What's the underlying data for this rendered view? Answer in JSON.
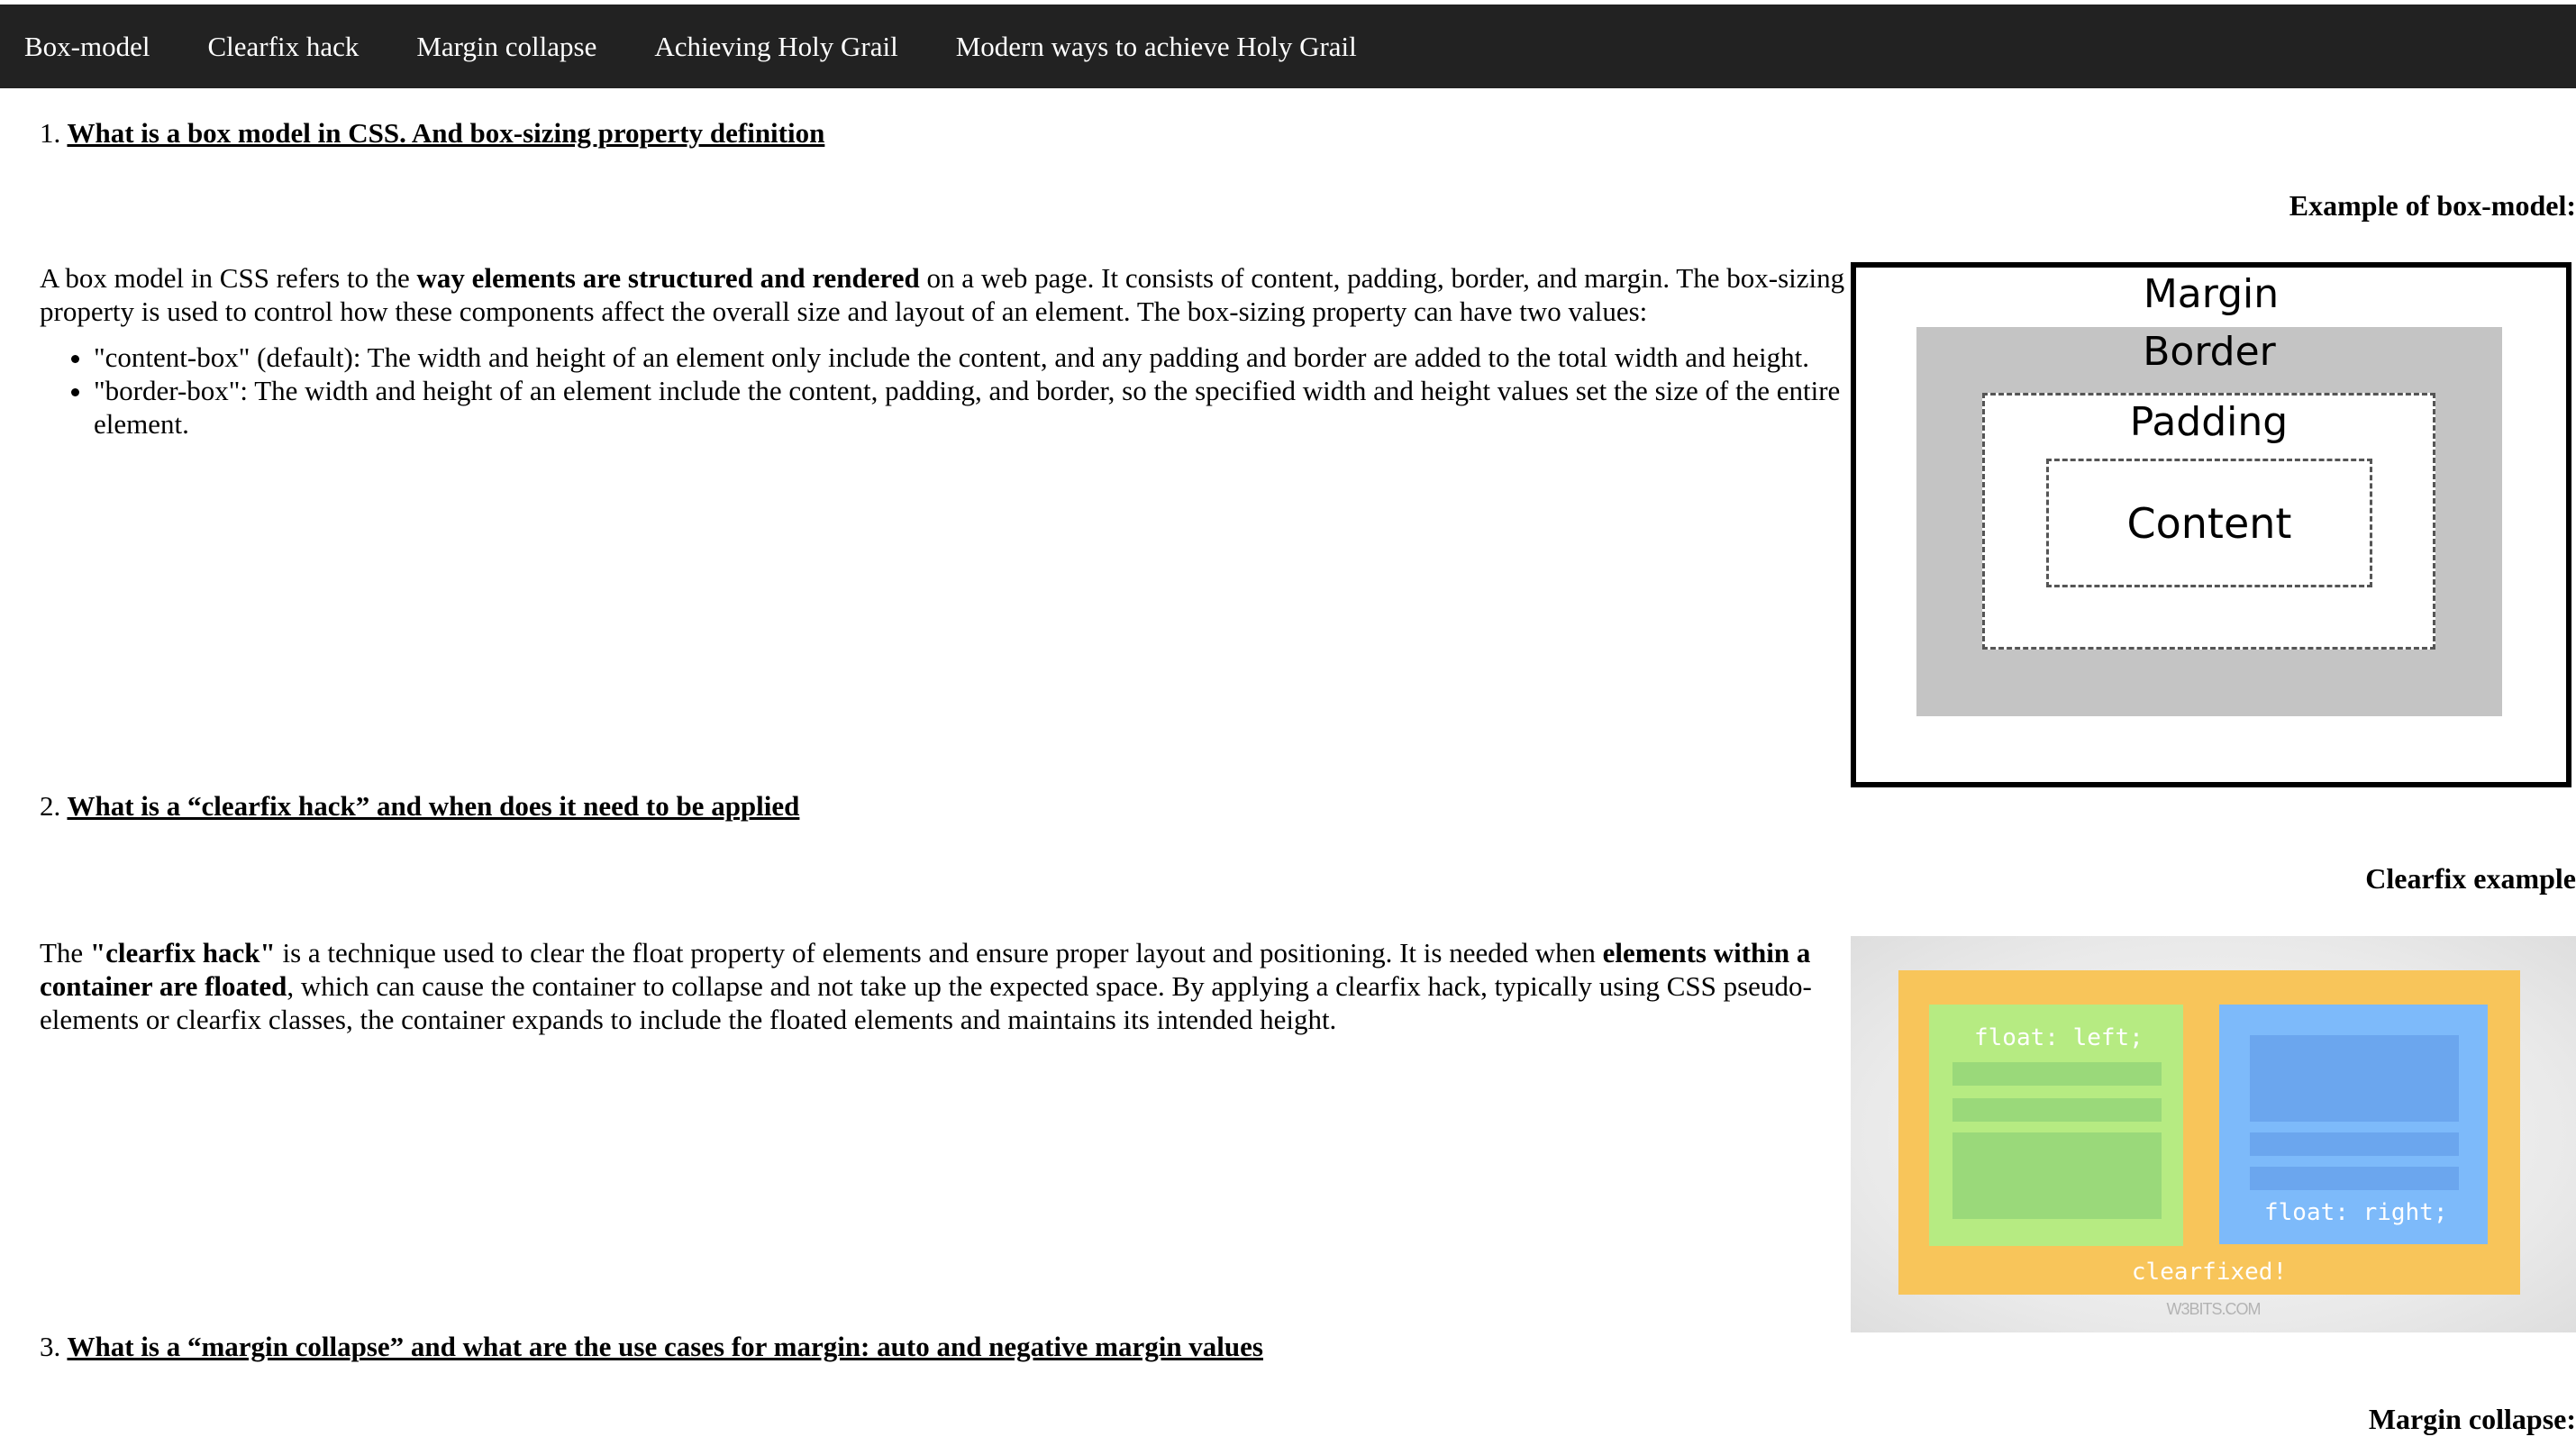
{
  "nav": {
    "items": [
      {
        "label": "Box-model"
      },
      {
        "label": "Clearfix hack"
      },
      {
        "label": "Margin collapse"
      },
      {
        "label": "Achieving Holy Grail"
      },
      {
        "label": "Modern ways to achieve Holy Grail"
      }
    ]
  },
  "sections": [
    {
      "number": "1.",
      "title": "What is a box model in CSS. And box-sizing property definition",
      "caption": "Example of box-model:",
      "para": {
        "t1": "A box model in CSS refers to the ",
        "b1": "way elements are structured and rendered",
        "t2": " on a web page. It consists of content, padding, border, and margin. The box-sizing property is used to control how these components affect the overall size and layout of an element. The box-sizing property can have two values:"
      },
      "bullets": [
        "\"content-box\" (default): The width and height of an element only include the content, and any padding and border are added to the total width and height.",
        "\"border-box\": The width and height of an element include the content, padding, and border, so the specified width and height values set the size of the entire element."
      ],
      "figure": {
        "margin": "Margin",
        "border": "Border",
        "padding": "Padding",
        "content": "Content"
      }
    },
    {
      "number": "2.",
      "title": "What is a “clearfix hack” and when does it need to be applied",
      "caption": "Clearfix example",
      "para": {
        "t1": "The ",
        "b1": "\"clearfix hack\"",
        "t2": " is a technique used to clear the float property of elements and ensure proper layout and positioning. It is needed when ",
        "b2": "elements within a container are floated",
        "t3": ", which can cause the container to collapse and not take up the expected space. By applying a clearfix hack, typically using CSS pseudo-elements or clearfix classes, the container expands to include the floated elements and maintains its intended height."
      },
      "figure": {
        "left": "float: left;",
        "right": "float: right;",
        "bottom": "clearfixed!",
        "watermark": "W3BITS.COM"
      }
    },
    {
      "number": "3.",
      "title": "What is a “margin collapse” and what are the use cases for margin: auto and negative margin values",
      "caption": "Margin collapse:"
    }
  ]
}
